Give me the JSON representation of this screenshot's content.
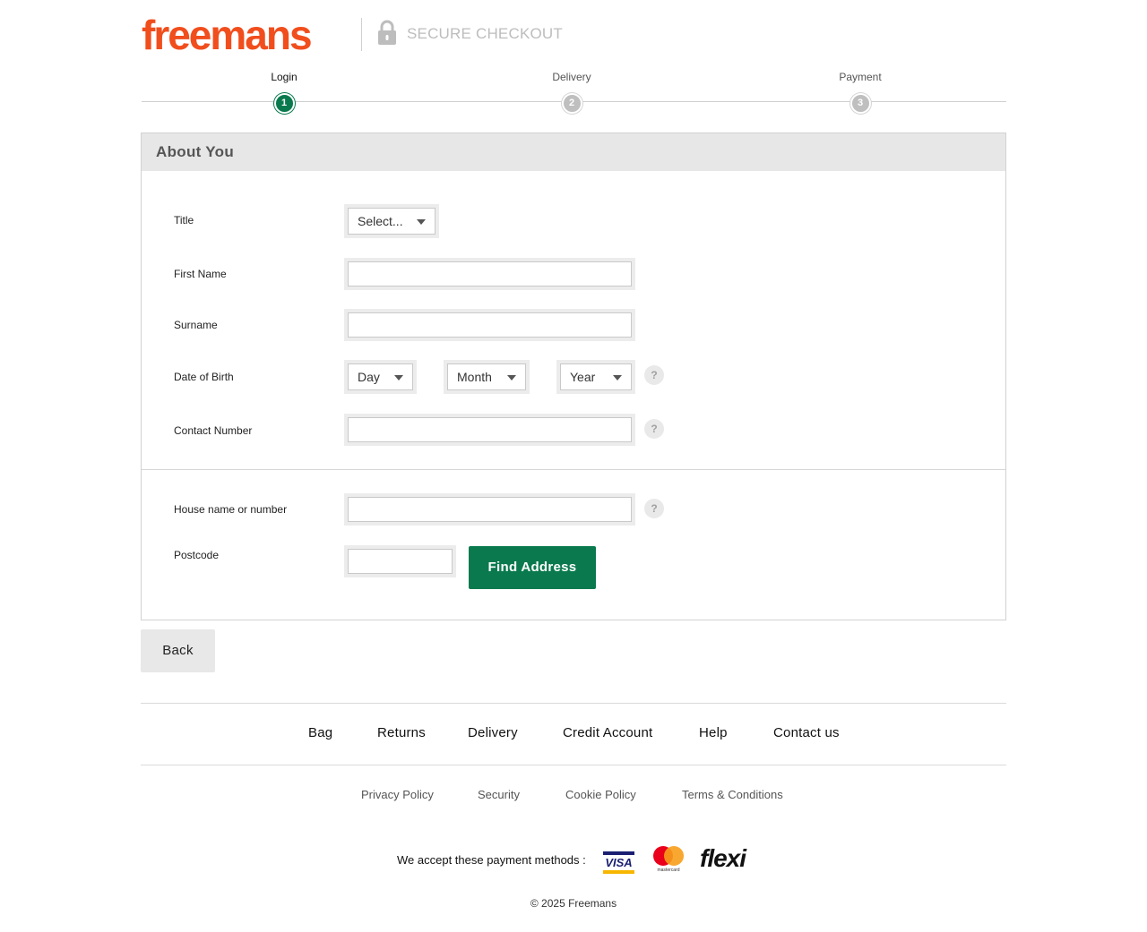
{
  "brand": {
    "logo_text": "freemans",
    "logo_color": "#f14e1d",
    "secure_text": "SECURE CHECKOUT"
  },
  "progress": {
    "steps": [
      {
        "label": "Login",
        "number": "1",
        "state": "active"
      },
      {
        "label": "Delivery",
        "number": "2",
        "state": "inactive"
      },
      {
        "label": "Payment",
        "number": "3",
        "state": "inactive"
      }
    ],
    "active_color": "#0a7a4e"
  },
  "form": {
    "heading": "About You",
    "title": {
      "label": "Title",
      "selected": "Select..."
    },
    "first_name": {
      "label": "First Name",
      "value": ""
    },
    "surname": {
      "label": "Surname",
      "value": ""
    },
    "dob": {
      "label": "Date of Birth",
      "day": "Day",
      "month": "Month",
      "year": "Year"
    },
    "contact": {
      "label": "Contact Number",
      "value": ""
    },
    "house": {
      "label": "House name or number",
      "value": ""
    },
    "postcode": {
      "label": "Postcode",
      "value": ""
    },
    "find_address": "Find Address",
    "help_glyph": "?"
  },
  "back": "Back",
  "footer": {
    "nav": [
      "Bag",
      "Returns",
      "Delivery",
      "Credit Account",
      "Help",
      "Contact us"
    ],
    "links": [
      "Privacy Policy",
      "Security",
      "Cookie Policy",
      "Terms & Conditions"
    ],
    "payment_text": "We accept these payment methods :",
    "payment_logos": {
      "visa": "VISA",
      "mastercard": "mastercard",
      "flexi": "flexi"
    },
    "copyright": "© 2025 Freemans"
  }
}
